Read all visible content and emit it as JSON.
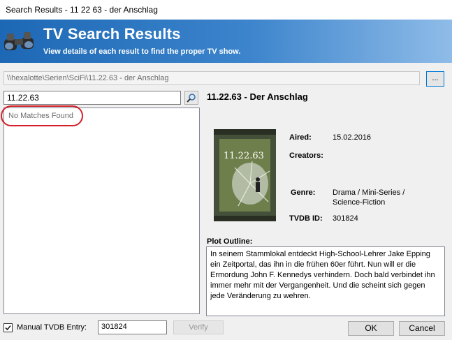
{
  "window": {
    "title": "Search Results - 11 22 63 - der Anschlag"
  },
  "banner": {
    "title": "TV Search Results",
    "subtitle": "View details of each result to find the proper TV show.",
    "icon": "binoculars-icon"
  },
  "path": {
    "value": "\\\\hexalotte\\Serien\\SciFi\\11.22.63 - der Anschlag",
    "browse_label": "..."
  },
  "search": {
    "value": "11.22.63",
    "icon": "search-icon"
  },
  "results": {
    "empty_text": "No Matches Found",
    "highlight_color": "#d4202a"
  },
  "details": {
    "show_title": "11.22.63 - Der Anschlag",
    "poster_text": "11.22.63",
    "aired_label": "Aired:",
    "aired_value": "15.02.2016",
    "creators_label": "Creators:",
    "creators_value": "",
    "genre_label": "Genre:",
    "genre_line1": "Drama / Mini-Series /",
    "genre_line2": "Science-Fiction",
    "tvdb_label": "TVDB ID:",
    "tvdb_value": "301824",
    "plot_label": "Plot Outline:",
    "plot_text": "In seinem Stammlokal entdeckt High-School-Lehrer Jake Epping ein Zeitportal, das ihn in die frühen 60er führt. Nun will er die Ermordung John F. Kennedys verhindern. Doch bald verbindet ihn immer mehr mit der Vergangenheit. Und die scheint sich gegen jede Veränderung zu wehren."
  },
  "footer": {
    "manual_checked": true,
    "manual_label": "Manual TVDB Entry:",
    "manual_value": "301824",
    "verify_label": "Verify",
    "ok_label": "OK",
    "cancel_label": "Cancel"
  },
  "colors": {
    "banner": "#2f78c4",
    "accent": "#0078d7"
  }
}
